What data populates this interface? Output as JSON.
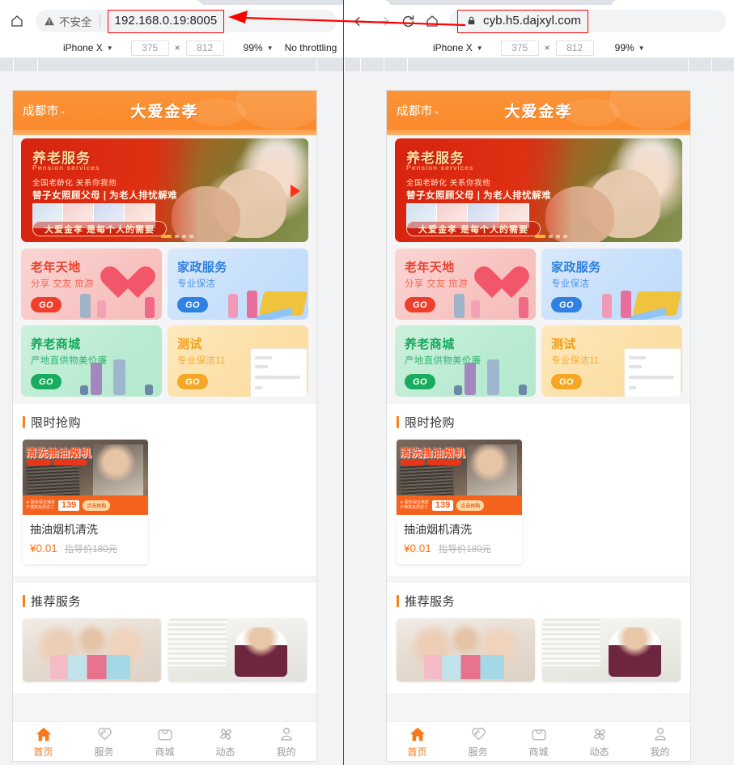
{
  "browsers": [
    {
      "id": "left",
      "security_label": "不安全",
      "security_icon": "warning-triangle-icon",
      "url": "192.168.0.19:8005",
      "url_highlighted": true,
      "home_icon": "home-icon",
      "device": {
        "name": "iPhone X",
        "width": "375",
        "x_label": "×",
        "height": "812",
        "zoom": "99%",
        "throttling": "No throttling"
      }
    },
    {
      "id": "right",
      "security_label": "",
      "security_icon": "lock-icon",
      "url": "cyb.h5.dajxyl.com",
      "url_highlighted": true,
      "back_icon": "arrow-left-icon",
      "forward_icon": "arrow-right-icon",
      "reload_icon": "reload-icon",
      "home_icon": "home-icon",
      "device": {
        "name": "iPhone X",
        "width": "375",
        "x_label": "×",
        "height": "812",
        "zoom": "99%",
        "throttling": ""
      }
    }
  ],
  "annotation": {
    "type": "red-arrow",
    "color": "#ff0000",
    "direction": "right-to-left"
  },
  "app": {
    "header": {
      "city": "成都市",
      "city_caret": "⌄",
      "title": "大爱金孝"
    },
    "banner": {
      "title_cn": "养老服务",
      "title_en": "Pension services",
      "line1": "全国老龄化  关系你我他",
      "line2": "替子女照顾父母 | 为老人排忧解难",
      "pill": "大爱金孝 是每个人的需要",
      "play_icon": "play-icon",
      "dots": 4,
      "active_dot": 1
    },
    "cards": [
      {
        "title": "老年天地",
        "sub": "分享 交友 旅游",
        "go": "GO",
        "theme": "red",
        "art": "heart"
      },
      {
        "title": "家政服务",
        "sub": "专业保洁",
        "go": "GO",
        "theme": "blue",
        "art": "cleaner"
      },
      {
        "title": "养老商城",
        "sub": "产地直供物美价廉",
        "go": "GO",
        "theme": "green",
        "art": "shoppers"
      },
      {
        "title": "测试",
        "sub": "专业保洁11",
        "go": "GO",
        "theme": "yellow",
        "art": "document"
      }
    ],
    "flash_sale": {
      "title": "限时抢购",
      "product": {
        "name": "抽油烟机清洗",
        "price": "¥0.01",
        "original_price": "指导价180元",
        "image_title": "清洗抽油烟机",
        "image_price": "139",
        "image_tag": "点击抢购"
      }
    },
    "recommended": {
      "title": "推荐服务",
      "items": [
        {
          "alt": "family-with-gifts-photo"
        },
        {
          "alt": "cleaning-lady-photo"
        }
      ]
    },
    "tabbar": [
      {
        "label": "首页",
        "icon": "home-filled-icon",
        "active": true
      },
      {
        "label": "服务",
        "icon": "handshake-icon",
        "active": false
      },
      {
        "label": "商城",
        "icon": "shopping-bag-icon",
        "active": false
      },
      {
        "label": "动态",
        "icon": "pinwheel-icon",
        "active": false
      },
      {
        "label": "我的",
        "icon": "person-icon",
        "active": false
      }
    ]
  },
  "colors": {
    "brand_orange": "#f7821e",
    "header_orange": "#fa8f30",
    "price_orange": "#fa7012",
    "highlight_red": "#ff0000"
  }
}
